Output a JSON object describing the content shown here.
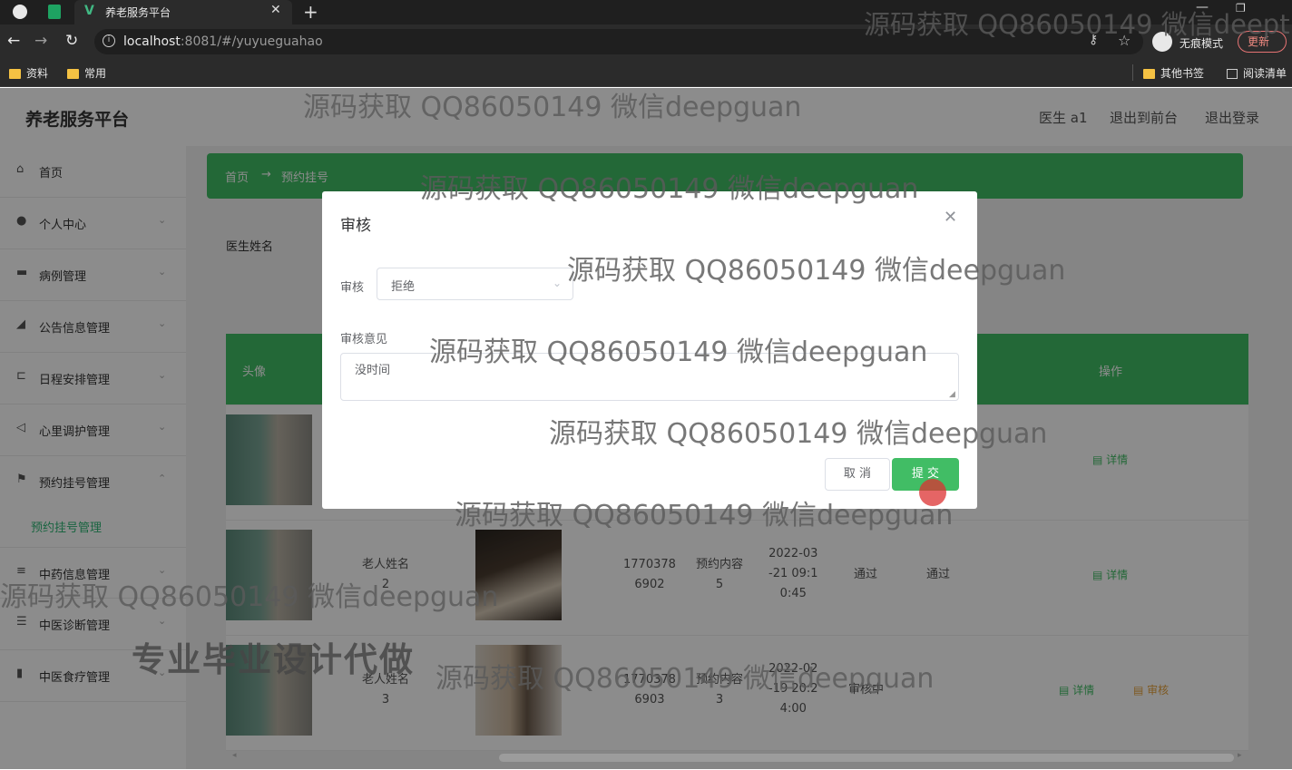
{
  "browser": {
    "tab_title": "养老服务平台",
    "url_host": "localhost",
    "url_rest": ":8081/#/yuyueguahao",
    "incognito_label": "无痕模式",
    "update_label": "更新",
    "bookmarks": [
      "资料",
      "常用"
    ],
    "other_bookmarks": "其他书签",
    "reading_list": "阅读清单"
  },
  "header": {
    "brand": "养老服务平台",
    "user": "医生 a1",
    "front_link": "退出到前台",
    "logout": "退出登录"
  },
  "sidebar": {
    "items": [
      {
        "label": "首页",
        "icon": "home-icon"
      },
      {
        "label": "个人中心",
        "icon": "user-icon"
      },
      {
        "label": "病例管理",
        "icon": "briefcase-icon"
      },
      {
        "label": "公告信息管理",
        "icon": "megaphone-icon"
      },
      {
        "label": "日程安排管理",
        "icon": "calendar-icon"
      },
      {
        "label": "心里调护管理",
        "icon": "send-icon"
      },
      {
        "label": "预约挂号管理",
        "icon": "flag-icon"
      },
      {
        "label": "中药信息管理",
        "icon": "list-icon"
      },
      {
        "label": "中医诊断管理",
        "icon": "menu-icon"
      },
      {
        "label": "中医食疗管理",
        "icon": "bar-chart-icon"
      }
    ],
    "submenu_active": "预约挂号管理"
  },
  "main": {
    "breadcrumb_home": "首页",
    "breadcrumb_arrow": "→",
    "breadcrumb_current": "预约挂号",
    "search_label": "医生姓名",
    "table_headers": [
      "头像",
      "操作"
    ],
    "rows": [
      {
        "name": "",
        "phone": "",
        "content": "",
        "time": "",
        "status1": "",
        "status2": "",
        "actions": [
          "详情"
        ]
      },
      {
        "name": "老人姓名\n2",
        "phone": "1770378\n6902",
        "content": "预约内容\n5",
        "time": "2022-03\n-21 09:1\n0:45",
        "status1": "通过",
        "status2": "通过",
        "actions": [
          "详情"
        ]
      },
      {
        "name": "老人姓名\n3",
        "phone": "1770378\n6903",
        "content": "预约内容\n3",
        "time": "2022-02\n-19 20:2\n4:00",
        "status1": "审核中",
        "status2": "",
        "actions": [
          "详情",
          "审核"
        ]
      }
    ]
  },
  "dialog": {
    "title": "审核",
    "review_label": "审核",
    "review_value": "拒绝",
    "opinion_label": "审核意见",
    "opinion_value": "没时间",
    "cancel_label": "取 消",
    "submit_label": "提 交"
  },
  "watermarks": {
    "text": "源码获取 QQ86050149 微信deepguan",
    "ad": "专业毕业设计代做",
    "top_right": "源码获取 QQ86050149 微信deept"
  },
  "colors": {
    "accent": "#41bd65",
    "chrome_bg": "#2b2b2b"
  }
}
